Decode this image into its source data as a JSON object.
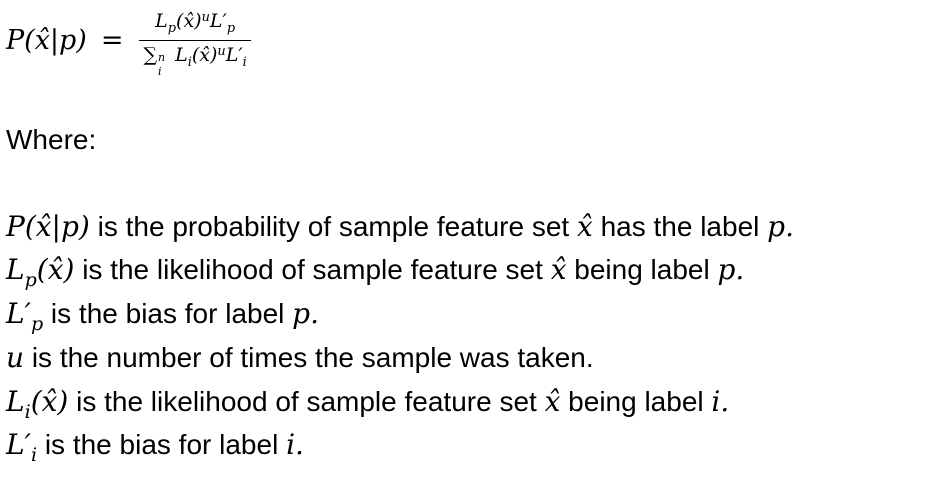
{
  "formula": {
    "lhs": "P(x̂|p)",
    "equals": "=",
    "numerator": "Lp(x̂)uL′p",
    "denominator": "∑ni Li(x̂)uL′i"
  },
  "where_label": "Where:",
  "definitions": [
    {
      "symbol": "P(x̂|p)",
      "text": " is the probability of sample feature set ",
      "var": "x̂",
      "text2": " has the label ",
      "end": "p."
    },
    {
      "symbol": "Lp(x̂)",
      "text": " is the likelihood of sample feature set ",
      "var": "x̂",
      "text2": " being label ",
      "end": "p."
    },
    {
      "symbol": "L′p",
      "text": " is the bias for label ",
      "end": "p."
    },
    {
      "symbol": "u",
      "text": " is the number of times the sample was taken."
    },
    {
      "symbol": "Li(x̂)",
      "text": " is the likelihood of sample feature set ",
      "var": "x̂",
      "text2": " being label ",
      "end": "i."
    },
    {
      "symbol": "L′i",
      "text": " is the bias for label ",
      "end": "i."
    }
  ]
}
